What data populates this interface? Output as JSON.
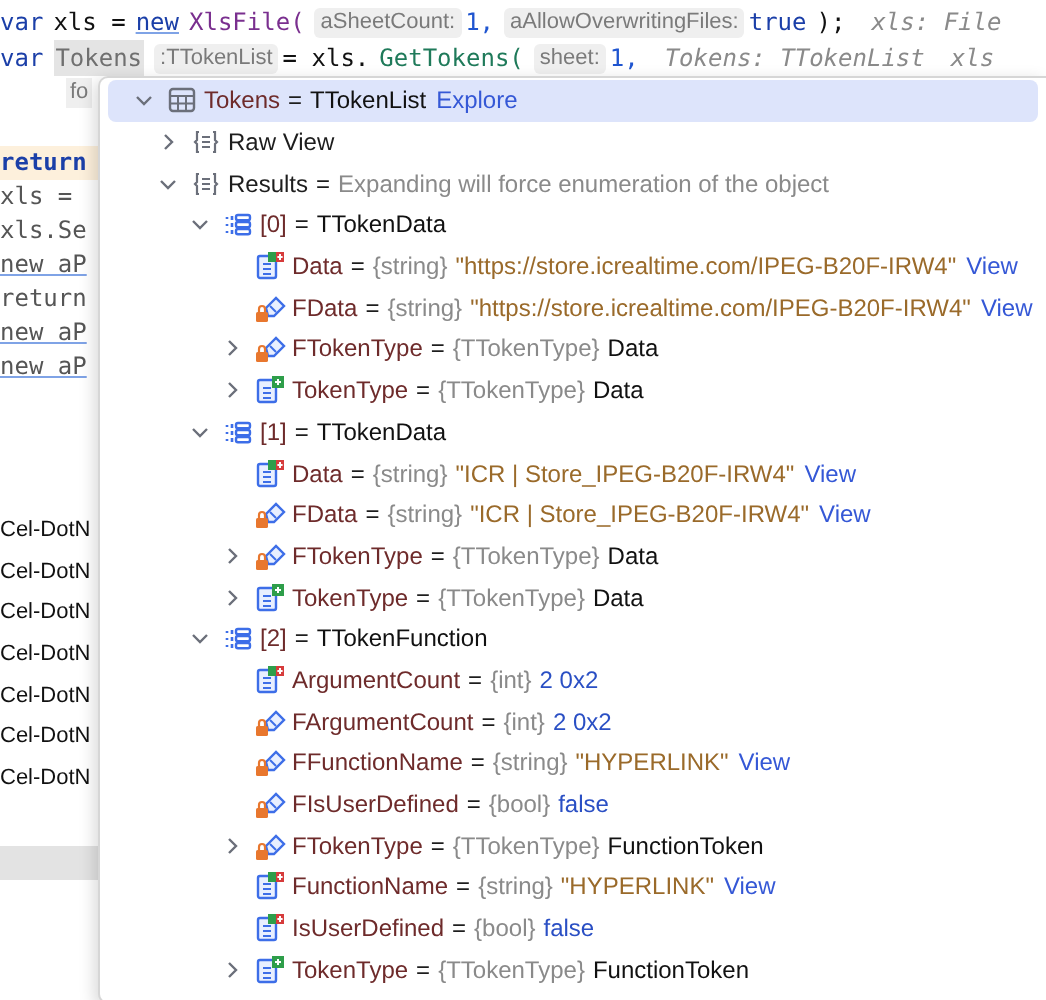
{
  "code_lines": [
    [
      {
        "kind": "keyword",
        "text": "var"
      },
      {
        "kind": "plain",
        "text": "xls ="
      },
      {
        "kind": "new",
        "text": "new"
      },
      {
        "kind": "call",
        "text": "XlsFile("
      },
      {
        "kind": "hint",
        "text": "aSheetCount:"
      },
      {
        "kind": "number",
        "text": "1,"
      },
      {
        "kind": "hint",
        "text": "aAllowOverwritingFiles:"
      },
      {
        "kind": "keyword",
        "text": "true"
      },
      {
        "kind": "plain",
        "text": ");"
      },
      {
        "kind": "inlay",
        "text": "xls: File"
      }
    ],
    [
      {
        "kind": "keyword",
        "text": "var"
      },
      {
        "kind": "marked",
        "text": "Tokens"
      },
      {
        "kind": "hint",
        "text": ":TTokenList"
      },
      {
        "kind": "plain",
        "text": "= xls."
      },
      {
        "kind": "method",
        "text": "GetTokens("
      },
      {
        "kind": "hint",
        "text": "sheet:"
      },
      {
        "kind": "number",
        "text": "1,"
      },
      {
        "kind": "inlay",
        "text": "Tokens: TTokenList"
      },
      {
        "kind": "inlay",
        "text": "xls"
      }
    ]
  ],
  "side_hint": "fo",
  "side_code": [
    {
      "kind": "current",
      "text": "return"
    },
    {
      "kind": "code",
      "text": "xls ="
    },
    {
      "kind": "code",
      "text": "xls.Se"
    },
    {
      "kind": "link",
      "text": "new aP"
    },
    {
      "kind": "code",
      "text": "return"
    },
    {
      "kind": "link",
      "text": "new aP"
    },
    {
      "kind": "link",
      "text": "new aP"
    }
  ],
  "side_output": [
    "Cel-DotN",
    "Cel-DotN",
    "Cel-DotN",
    "Cel-DotN",
    "Cel-DotN",
    "Cel-DotN",
    "Cel-DotN"
  ],
  "popup": {
    "header": {
      "kind": "table",
      "name": "Tokens",
      "equals": "=",
      "value": "TTokenList",
      "link": "Explore",
      "selected": true,
      "expanded": true
    },
    "items": [
      {
        "kind": "braces",
        "name": "Raw View",
        "expanded": false
      },
      {
        "kind": "braces",
        "name": "Results",
        "equals": "=",
        "note": "Expanding will force enumeration of the object",
        "expanded": true,
        "children": [
          {
            "kind": "array",
            "name": "[0]",
            "equals": "=",
            "value": "TTokenData",
            "expanded": true,
            "children": [
              {
                "kind": "property-override",
                "name": "Data",
                "equals": "=",
                "type": "{string}",
                "string_value": "\"https://store.icrealtime.com/IPEG-B20F-IRW4\"",
                "link": "View"
              },
              {
                "kind": "field",
                "name": "FData",
                "equals": "=",
                "type": "{string}",
                "string_value": "\"https://store.icrealtime.com/IPEG-B20F-IRW4\"",
                "link": "View"
              },
              {
                "kind": "field",
                "name": "FTokenType",
                "equals": "=",
                "type": "{TTokenType}",
                "value": "Data",
                "expanded": false
              },
              {
                "kind": "property",
                "name": "TokenType",
                "equals": "=",
                "type": "{TTokenType}",
                "value": "Data",
                "expanded": false
              }
            ]
          },
          {
            "kind": "array",
            "name": "[1]",
            "equals": "=",
            "value": "TTokenData",
            "expanded": true,
            "children": [
              {
                "kind": "property-override",
                "name": "Data",
                "equals": "=",
                "type": "{string}",
                "string_value": "\"ICR | Store_IPEG-B20F-IRW4\"",
                "link": "View"
              },
              {
                "kind": "field",
                "name": "FData",
                "equals": "=",
                "type": "{string}",
                "string_value": "\"ICR | Store_IPEG-B20F-IRW4\"",
                "link": "View"
              },
              {
                "kind": "field",
                "name": "FTokenType",
                "equals": "=",
                "type": "{TTokenType}",
                "value": "Data",
                "expanded": false
              },
              {
                "kind": "property",
                "name": "TokenType",
                "equals": "=",
                "type": "{TTokenType}",
                "value": "Data",
                "expanded": false
              }
            ]
          },
          {
            "kind": "array",
            "name": "[2]",
            "equals": "=",
            "value": "TTokenFunction",
            "expanded": true,
            "children": [
              {
                "kind": "property-override",
                "name": "ArgumentCount",
                "equals": "=",
                "type": "{int}",
                "number_value": "2 0x2"
              },
              {
                "kind": "field",
                "name": "FArgumentCount",
                "equals": "=",
                "type": "{int}",
                "number_value": "2 0x2"
              },
              {
                "kind": "field",
                "name": "FFunctionName",
                "equals": "=",
                "type": "{string}",
                "string_value": "\"HYPERLINK\"",
                "link": "View"
              },
              {
                "kind": "field",
                "name": "FIsUserDefined",
                "equals": "=",
                "type": "{bool}",
                "number_value": "false"
              },
              {
                "kind": "field",
                "name": "FTokenType",
                "equals": "=",
                "type": "{TTokenType}",
                "value": "FunctionToken",
                "expanded": false
              },
              {
                "kind": "property-override",
                "name": "FunctionName",
                "equals": "=",
                "type": "{string}",
                "string_value": "\"HYPERLINK\"",
                "link": "View"
              },
              {
                "kind": "property-override",
                "name": "IsUserDefined",
                "equals": "=",
                "type": "{bool}",
                "number_value": "false"
              },
              {
                "kind": "property",
                "name": "TokenType",
                "equals": "=",
                "type": "{TTokenType}",
                "value": "FunctionToken",
                "expanded": false
              }
            ]
          }
        ]
      }
    ]
  }
}
